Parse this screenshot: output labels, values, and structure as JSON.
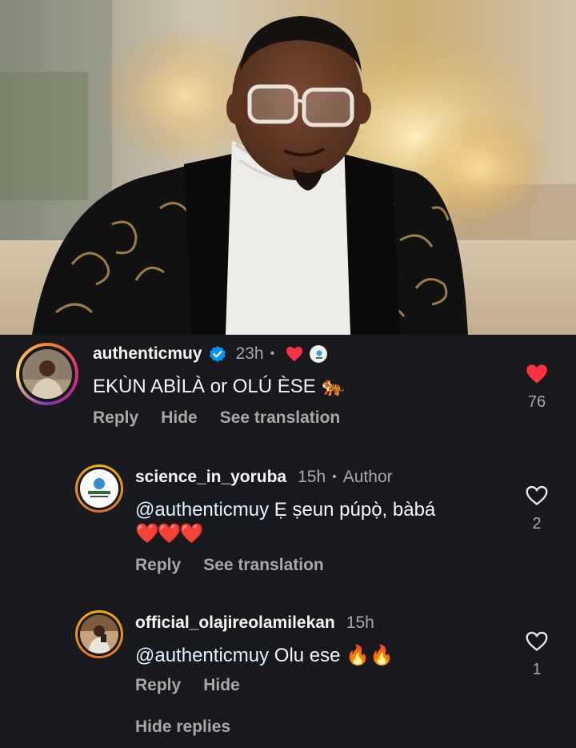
{
  "comments": [
    {
      "username": "authenticmuy",
      "verified": true,
      "time": "23h",
      "text": "EKÙN ABÌLÀ or OLÚ ÈSE 🐅",
      "actions": [
        "Reply",
        "Hide",
        "See translation"
      ],
      "likes": "76",
      "liked": true,
      "liked_by_author_icon": "heart-icon"
    },
    {
      "username": "science_in_yoruba",
      "time": "15h",
      "author_label": "Author",
      "mention": "@authenticmuy",
      "text": " Ẹ ṣeun púpọ̀, bàbá",
      "text_line2": "❤️❤️❤️",
      "actions": [
        "Reply",
        "See translation"
      ],
      "likes": "2",
      "liked": false
    },
    {
      "username": "official_olajireolamilekan",
      "time": "15h",
      "mention": "@authenticmuy",
      "text": " Olu ese 🔥🔥",
      "actions": [
        "Reply",
        "Hide"
      ],
      "likes": "1",
      "liked": false
    }
  ],
  "hide_replies": "Hide replies",
  "colors": {
    "background": "#18191c",
    "like_red": "#ff3040",
    "verified_blue": "#0095f6",
    "secondary": "#a8a8a8"
  }
}
